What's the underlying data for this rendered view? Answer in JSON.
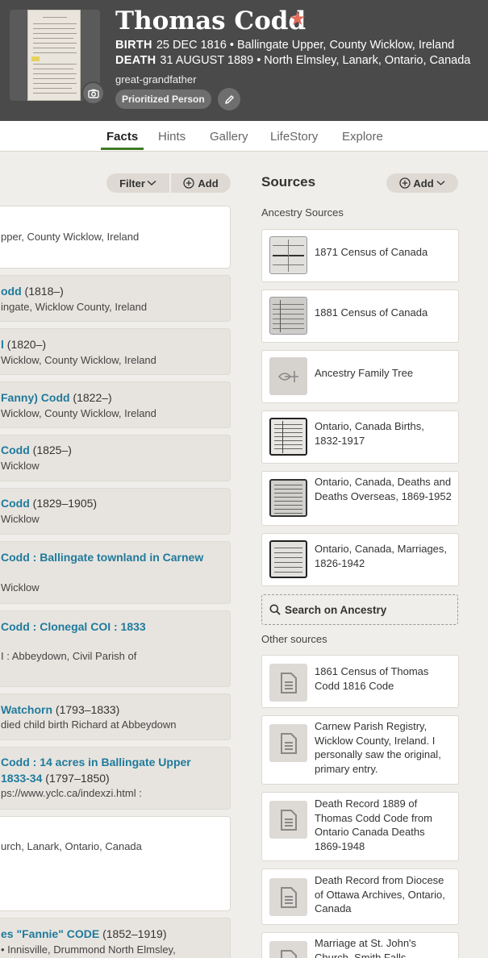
{
  "person": {
    "name": "Thomas Codd",
    "birth_label": "BIRTH",
    "birth_value": "25 DEC 1816 • Ballingate Upper, County Wicklow, Ireland",
    "death_label": "DEATH",
    "death_value": "31 AUGUST 1889 • North Elmsley, Lanark, Ontario, Canada",
    "relationship": "great-grandfather",
    "badge": "Prioritized Person"
  },
  "tabs": [
    {
      "label": "Facts",
      "active": true
    },
    {
      "label": "Hints"
    },
    {
      "label": "Gallery"
    },
    {
      "label": "LifeStory"
    },
    {
      "label": "Explore"
    }
  ],
  "facts_toolbar": {
    "filter_label": "Filter",
    "add_label": "Add"
  },
  "facts": [
    {
      "line1": "pper, County Wicklow, Ireland"
    },
    {
      "name": "odd",
      "years": " (1818–)",
      "place": "ingate, Wicklow County, Ireland"
    },
    {
      "name": "l",
      "years": " (1820–)",
      "place": " Wicklow, County Wicklow, Ireland"
    },
    {
      "name": "Fanny) Codd",
      "years": " (1822–)",
      "place": " Wicklow, County Wicklow, Ireland"
    },
    {
      "name": "Codd",
      "years": " (1825–)",
      "place": " Wicklow"
    },
    {
      "name": "Codd",
      "years": " (1829–1905)",
      "place": " Wicklow"
    },
    {
      "name": "Codd : Ballingate townland in Carnew",
      "place": " Wicklow"
    },
    {
      "name": " Codd : Clonegal COI : 1833",
      "place": "I : Abbeydown, Civil Parish of"
    },
    {
      "name": "Watchorn",
      "years": " (1793–1833)",
      "place": " died child birth Richard at Abbeydown"
    },
    {
      "name": "Codd : 14 acres in Ballingate Upper",
      "name2": " 1833-34",
      "years": " (1797–1850)",
      "place": "ps://www.yclc.ca/indexzi.html :"
    },
    {
      "place": "urch, Lanark, Ontario, Canada"
    },
    {
      "name": "es \"Fannie\" CODE",
      "years": " (1852–1919)",
      "place": "• Innisville, Drummond North Elmsley,"
    }
  ],
  "sources": {
    "title": "Sources",
    "add_label": "Add",
    "ancestry_heading": "Ancestry Sources",
    "ancestry": [
      {
        "title": "1871 Census of Canada",
        "thumb": "census-image-icon"
      },
      {
        "title": "1881 Census of Canada",
        "thumb": "census-image-icon"
      },
      {
        "title": "Ancestry Family Tree",
        "thumb": "leaf-icon"
      },
      {
        "title": "Ontario, Canada Births, 1832-1917",
        "thumb": "record-image-icon"
      },
      {
        "title": "Ontario, Canada, Deaths and Deaths Overseas, 1869-1952",
        "thumb": "record-image-icon"
      },
      {
        "title": "Ontario, Canada, Marriages, 1826-1942",
        "thumb": "record-image-icon"
      }
    ],
    "search_label": "Search on Ancestry",
    "other_heading": "Other sources",
    "other": [
      {
        "title": "1861 Census of Thomas Codd 1816 Code"
      },
      {
        "title": "Carnew Parish Registry, Wicklow County, Ireland. I personally saw the original, primary entry."
      },
      {
        "title": "Death Record 1889 of Thomas Codd Code from Ontario Canada Deaths 1869-1948"
      },
      {
        "title": "Death Record from Diocese of Ottawa Archives, Ontario, Canada"
      },
      {
        "title": "Marriage at St. John's Church, Smith Falls"
      }
    ]
  },
  "colors": {
    "header_bg": "#4a4a4a",
    "accent_green": "#3e7a26",
    "link_blue": "#1f7a9c",
    "star": "#e26b5b"
  }
}
